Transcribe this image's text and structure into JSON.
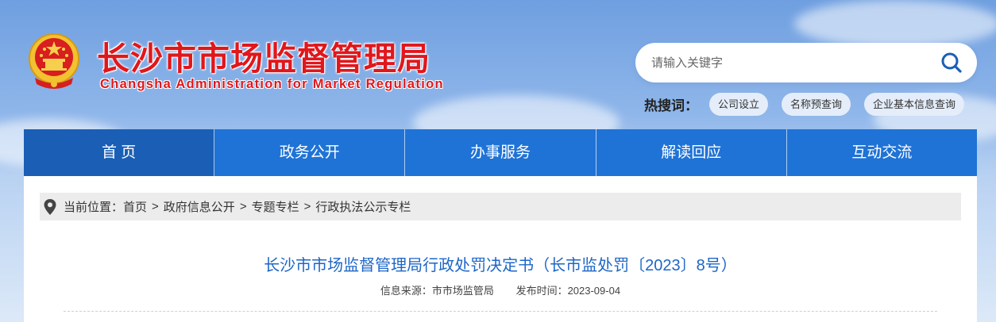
{
  "header": {
    "title": "长沙市市场监督管理局",
    "subtitle": "Changsha Administration for Market Regulation",
    "search": {
      "placeholder": "请输入关键字"
    },
    "hot_label": "热搜词：",
    "hot_tags": [
      "公司设立",
      "名称预查询",
      "企业基本信息查询"
    ],
    "emblem_icon": "national-emblem-icon"
  },
  "nav": {
    "items": [
      "首 页",
      "政务公开",
      "办事服务",
      "解读回应",
      "互动交流"
    ],
    "active_index": 0
  },
  "breadcrumb": {
    "prefix": "当前位置：",
    "items": [
      "首页",
      "政府信息公开",
      "专题专栏",
      "行政执法公示专栏"
    ],
    "separator": ">"
  },
  "article": {
    "title": "长沙市市场监督管理局行政处罚决定书（长市监处罚〔2023〕8号）",
    "source": "信息来源：市市场监管局",
    "published": "发布时间：2023-09-04"
  },
  "colors": {
    "brand_red": "#e0171c",
    "nav_blue": "#1f73d6",
    "nav_active": "#1a5fb5",
    "title_blue": "#1d66c7"
  }
}
